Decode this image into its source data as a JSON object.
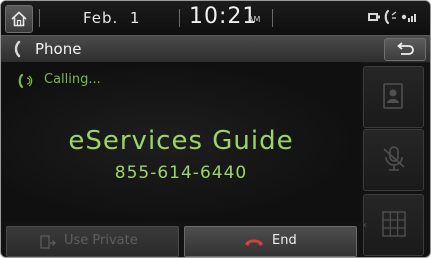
{
  "status_bar": {
    "date": "Feb.  1",
    "time": "10:21",
    "ampm": "AM",
    "icons": [
      "battery-icon",
      "phone-signal-icon",
      "signal-icon"
    ]
  },
  "title_bar": {
    "title": "Phone",
    "icons": [
      "phone-handset-icon",
      "back-arrow-icon"
    ]
  },
  "call": {
    "status": "Calling...",
    "contact": "eServices Guide",
    "number": "855-614-6440"
  },
  "side_buttons": [
    {
      "name": "contacts-button",
      "icon": "contact-card-icon"
    },
    {
      "name": "mute-mic-button",
      "icon": "mic-off-icon"
    },
    {
      "name": "keypad-button",
      "icon": "keypad-icon"
    }
  ],
  "bottom_buttons": {
    "use_private": "Use Private",
    "end": "End"
  },
  "colors": {
    "accent_green": "#9dd468",
    "end_red": "#d8413a",
    "background": "#121212"
  }
}
